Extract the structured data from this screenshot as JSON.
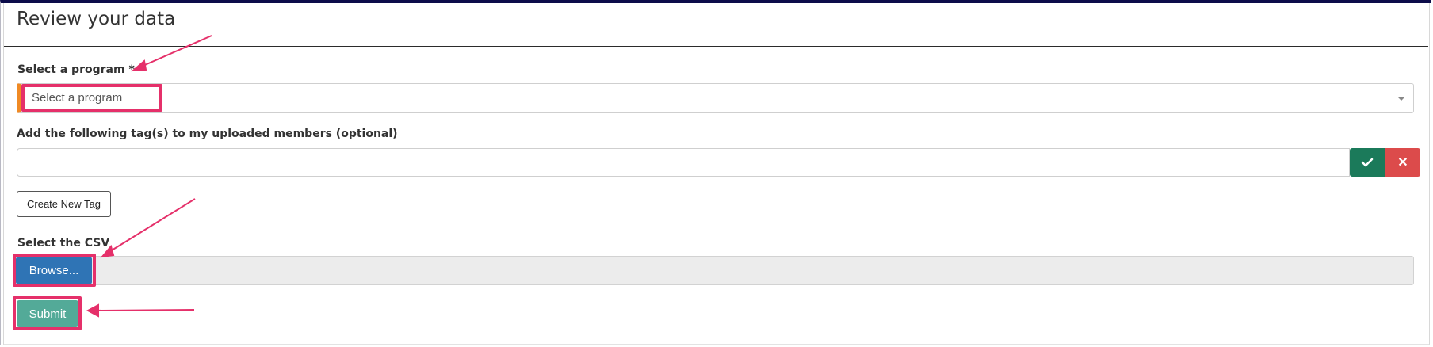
{
  "page": {
    "title": "Review your data"
  },
  "program": {
    "label": "Select a program *",
    "placeholder": "Select a program",
    "caret_icon": "caret-down-icon"
  },
  "tags": {
    "label": "Add the following tag(s) to my uploaded members (optional)",
    "value": "",
    "confirm_icon": "check-icon",
    "cancel_icon": "close-icon",
    "cancel_glyph": "✕",
    "create_label": "Create New Tag"
  },
  "csv": {
    "label": "Select the CSV",
    "browse_label": "Browse..."
  },
  "submit": {
    "label": "Submit"
  },
  "colors": {
    "highlight": "#e5306a",
    "accent_orange": "#f08a24",
    "confirm_green": "#1b7a5a",
    "cancel_red": "#dc4b4b",
    "browse_blue": "#2f74b5",
    "submit_teal": "#53aa98"
  }
}
